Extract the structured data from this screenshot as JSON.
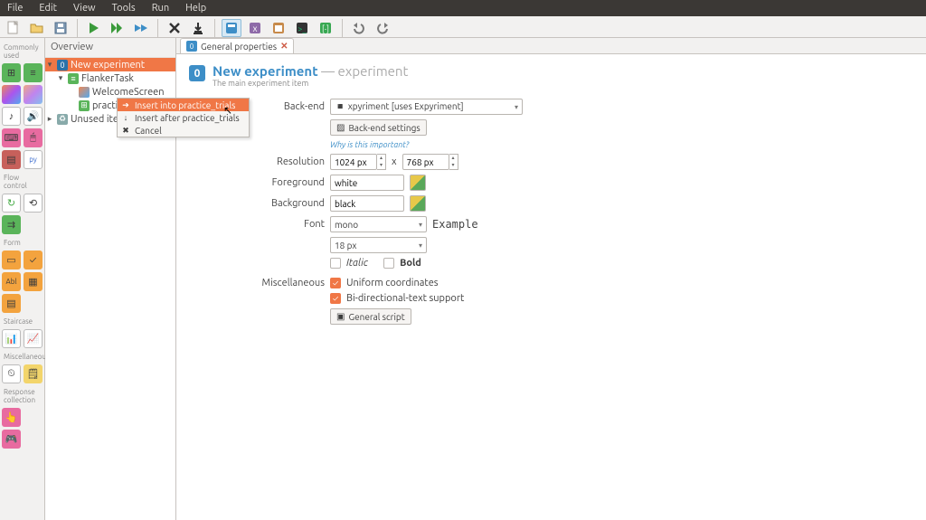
{
  "menubar": [
    "File",
    "Edit",
    "View",
    "Tools",
    "Run",
    "Help"
  ],
  "overview": {
    "title": "Overview"
  },
  "tree": {
    "root": "New experiment",
    "seq": "FlankerTask",
    "item1": "WelcomeScreen",
    "item2": "practice_trials",
    "unused": "Unused items"
  },
  "tab": {
    "label": "General properties"
  },
  "header": {
    "title": "New experiment",
    "suffix": " — experiment",
    "sub": "The main experiment item"
  },
  "form": {
    "backend": {
      "label": "Back-end",
      "value": "xpyriment [uses Expyriment]",
      "btn": "Back-end settings",
      "hint": "Why is this important?"
    },
    "resolution": {
      "label": "Resolution",
      "w": "1024 px",
      "h": "768 px",
      "x": "x"
    },
    "foreground": {
      "label": "Foreground",
      "value": "white"
    },
    "background": {
      "label": "Background",
      "value": "black"
    },
    "font": {
      "label": "Font",
      "family": "mono",
      "size": "18 px",
      "example": "Example",
      "italic": "Italic",
      "bold": "Bold"
    },
    "misc": {
      "label": "Miscellaneous",
      "uni": "Uniform coordinates",
      "bidi": "Bi-directional-text support",
      "script": "General script"
    }
  },
  "ctx": {
    "into": "Insert into practice_trials",
    "after": "Insert after practice_trials",
    "cancel": "Cancel"
  },
  "toolbox": {
    "cat": [
      "Commonly used",
      "Flow control",
      "Form",
      "Staircase",
      "Miscellaneous",
      "Response collection"
    ]
  }
}
